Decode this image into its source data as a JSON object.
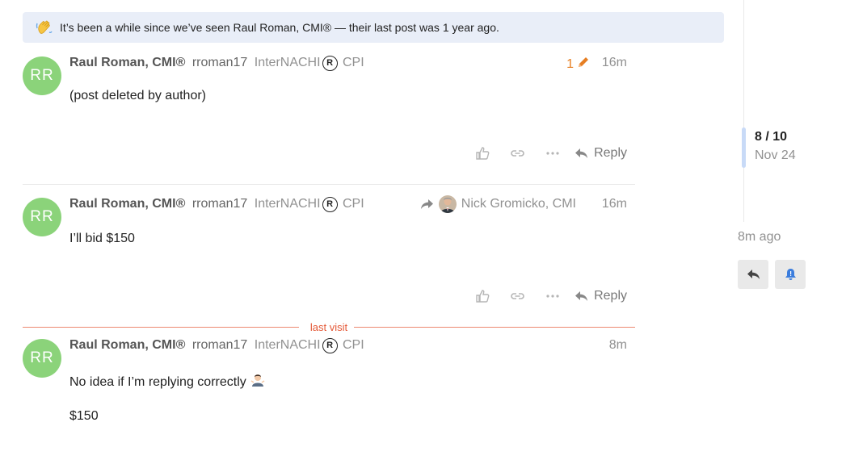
{
  "banner": {
    "text": "It’s been a while since we’ve seen Raul Roman, CMI® — their last post was 1 year ago.",
    "icon": "waving-hand-icon"
  },
  "posts": [
    {
      "avatar_initials": "RR",
      "author_name": "Raul Roman, CMI®",
      "username": "rroman17",
      "title_prefix": "InterNACHI",
      "title_suffix": "CPI",
      "edit_count": "1",
      "time": "16m",
      "body": [
        "(post deleted by author)"
      ],
      "reply_label": "Reply"
    },
    {
      "avatar_initials": "RR",
      "author_name": "Raul Roman, CMI®",
      "username": "rroman17",
      "title_prefix": "InterNACHI",
      "title_suffix": "CPI",
      "reply_to_name": "Nick Gromicko, CMI",
      "time": "16m",
      "body": [
        "I’ll bid $150"
      ],
      "reply_label": "Reply"
    },
    {
      "avatar_initials": "RR",
      "author_name": "Raul Roman, CMI®",
      "username": "rroman17",
      "title_prefix": "InterNACHI",
      "title_suffix": "CPI",
      "time": "8m",
      "body": [
        "No idea if I’m replying correctly",
        "$150"
      ],
      "body_emoji": "person-shrugging-icon"
    }
  ],
  "last_visit_label": "last visit",
  "timeline": {
    "count": "8 / 10",
    "date": "Nov 24",
    "ago": "8m ago"
  },
  "colors": {
    "avatar": "#8bd37a",
    "banner_bg": "#e9eef8",
    "edit": "#e67e22",
    "last_visit": "#e45735",
    "bell": "#3b7ddd"
  }
}
